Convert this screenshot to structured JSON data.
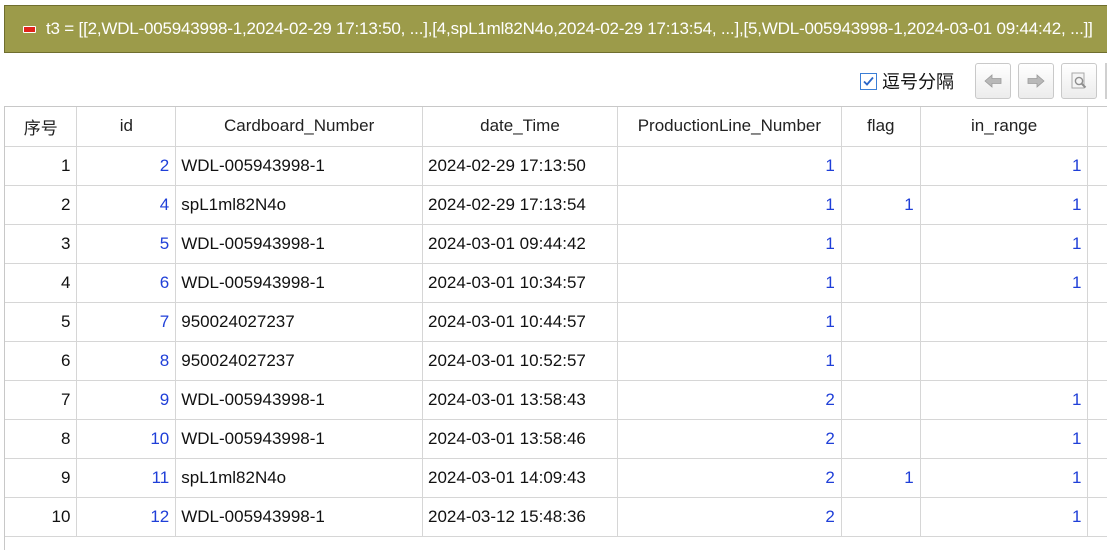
{
  "title_bar": {
    "text": "t3 = [[2,WDL-005943998-1,2024-02-29 17:13:50, ...],[4,spL1ml82N4o,2024-02-29 17:13:54, ...],[5,WDL-005943998-1,2024-03-01 09:44:42, ...]]",
    "icon": "variable-icon",
    "background_color": "#9c9b4a"
  },
  "toolbar": {
    "comma_separated_label": "逗号分隔",
    "comma_separated_checked": true,
    "buttons": [
      {
        "icon": "arrow-left-icon"
      },
      {
        "icon": "arrow-right-icon"
      },
      {
        "icon": "preview-icon"
      }
    ]
  },
  "table": {
    "columns": [
      "序号",
      "id",
      "Cardboard_Number",
      "date_Time",
      "ProductionLine_Number",
      "flag",
      "in_range"
    ],
    "rows": [
      {
        "seq": "1",
        "id": "2",
        "cardboard": "WDL-005943998-1",
        "time": "2024-02-29 17:13:50",
        "line": "1",
        "flag": "",
        "in_range": "1"
      },
      {
        "seq": "2",
        "id": "4",
        "cardboard": "spL1ml82N4o",
        "time": "2024-02-29 17:13:54",
        "line": "1",
        "flag": "1",
        "in_range": "1"
      },
      {
        "seq": "3",
        "id": "5",
        "cardboard": "WDL-005943998-1",
        "time": "2024-03-01 09:44:42",
        "line": "1",
        "flag": "",
        "in_range": "1"
      },
      {
        "seq": "4",
        "id": "6",
        "cardboard": "WDL-005943998-1",
        "time": "2024-03-01 10:34:57",
        "line": "1",
        "flag": "",
        "in_range": "1"
      },
      {
        "seq": "5",
        "id": "7",
        "cardboard": "950024027237",
        "time": "2024-03-01 10:44:57",
        "line": "1",
        "flag": "",
        "in_range": ""
      },
      {
        "seq": "6",
        "id": "8",
        "cardboard": "950024027237",
        "time": "2024-03-01 10:52:57",
        "line": "1",
        "flag": "",
        "in_range": ""
      },
      {
        "seq": "7",
        "id": "9",
        "cardboard": "WDL-005943998-1",
        "time": "2024-03-01 13:58:43",
        "line": "2",
        "flag": "",
        "in_range": "1"
      },
      {
        "seq": "8",
        "id": "10",
        "cardboard": "WDL-005943998-1",
        "time": "2024-03-01 13:58:46",
        "line": "2",
        "flag": "",
        "in_range": "1"
      },
      {
        "seq": "9",
        "id": "11",
        "cardboard": "spL1ml82N4o",
        "time": "2024-03-01 14:09:43",
        "line": "2",
        "flag": "1",
        "in_range": "1"
      },
      {
        "seq": "10",
        "id": "12",
        "cardboard": "WDL-005943998-1",
        "time": "2024-03-12 15:48:36",
        "line": "2",
        "flag": "",
        "in_range": "1"
      }
    ]
  },
  "colors": {
    "numeric_value": "#1f3fd8",
    "grid_line": "#d6d6d6"
  }
}
